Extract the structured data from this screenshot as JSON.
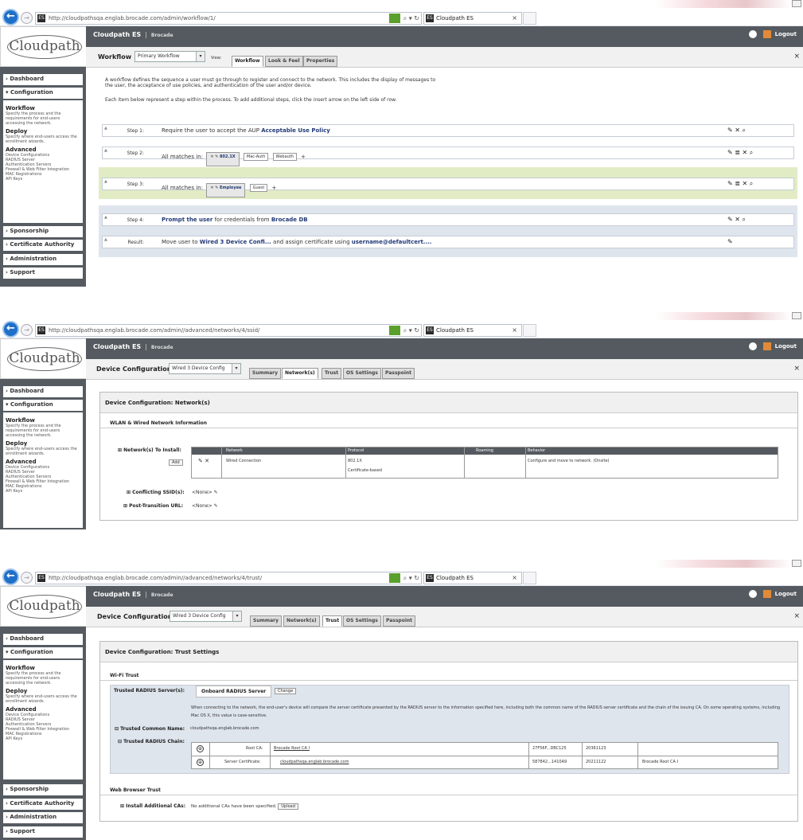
{
  "browser": {
    "tab_title": "Cloudpath ES",
    "url_prefix": "http://cloudpathsqa.englab.",
    "url_domain": "brocade.com",
    "urls": [
      "/admin/workflow/1/",
      "/admin//advanced/networks/4/ssid/",
      "/admin//advanced/networks/4/trust/"
    ],
    "url_controls": "⌕ ▾ ↻",
    "tab_close": "×",
    "back": "←",
    "forward": "→",
    "favicon": "ES"
  },
  "app": {
    "logo_text": "Cloudpath",
    "brand": "Cloudpath ES",
    "brand_sub": "Brocade",
    "brand_sep": "|",
    "logout": "Logout",
    "close": "×"
  },
  "sidebar": {
    "dashboard": "› Dashboard",
    "configuration": "▾ Configuration",
    "workflow_h": "Workflow",
    "workflow_t": "Specify the process and the requirements for end-users accessing the network.",
    "deploy_h": "Deploy",
    "deploy_t": "Specify where end-users access the enrollment wizards.",
    "advanced_h": "Advanced",
    "advanced_items": [
      "Device Configurations",
      "RADIUS Server",
      "Authentication Servers",
      "Firewall & Web Filter Integration",
      "MAC Registrations",
      "API Keys"
    ],
    "sponsorship": "› Sponsorship",
    "cert_auth": "› Certificate Authority",
    "administration": "› Administration",
    "support": "› Support"
  },
  "workflow": {
    "label": "Workflow",
    "select": "Primary Workflow",
    "view_label": "View:",
    "tabs": [
      "Workflow",
      "Look & Feel",
      "Properties"
    ],
    "intro_1": "A workflow defines the sequence a user must go through to register and connect to the network. This includes the display of messages to the user, the acceptance of use policies, and authentication of the user and/or device.",
    "intro_2": "Each item below represent a step within the process. To add additional steps, click the insert arrow on the left side of row.",
    "step1_num": "Step 1:",
    "step1_text": "Require the user to accept the AUP",
    "step1_bold": "Acceptable Use Policy",
    "step2_num": "Step 2:",
    "step2_text": "All matches in:",
    "step2_chips": [
      "802.1X",
      "Mac-Auth",
      "Webauth"
    ],
    "step3_num": "Step 3:",
    "step3_text": "All matches in:",
    "step3_chips": [
      "Employee",
      "Guest"
    ],
    "step4_num": "Step 4:",
    "step4_bold": "Prompt the user",
    "step4_text": "for credentials from",
    "step4_bold2": "Brocade DB",
    "result_num": "Result:",
    "result_pre": "Move user to",
    "result_bold": "Wired 3 Device Confi...",
    "result_mid": "and assign certificate using",
    "result_bold2": "username@defaultcert....",
    "plus": "+",
    "acts_std": "✎ ✕ ⌕",
    "acts_list": "✎ ≣ ✕ ⌕",
    "acts_edit": "✎",
    "chip_ctrl": "✕ ✎",
    "grip": "▲"
  },
  "devconf": {
    "label": "Device Configuration",
    "select": "Wired 3 Device Config",
    "tabs": [
      "Summary",
      "Network(s)",
      "Trust",
      "OS Settings",
      "Passpoint"
    ]
  },
  "networks": {
    "heading": "Device Configuration: Network(s)",
    "section": "WLAN & Wired Network Information",
    "nets_label": "Network(s) To Install:",
    "add": "Add",
    "cols": [
      "Network",
      "Protocol",
      "Roaming",
      "Behavior"
    ],
    "row_network": "Wired Connection",
    "row_protocol": "802.1X",
    "row_protocol_sub": "Certificate-based",
    "row_behavior": "Configure and move to network. (Onsite)",
    "row_ctrl": "✎ ✕",
    "ssid_label": "Conflicting SSID(s):",
    "ssid_val": "<None>",
    "ptu_label": "Post-Transition URL:",
    "ptu_val": "<None>",
    "edit": "✎",
    "expand": "⊞"
  },
  "trust": {
    "heading": "Device Configuration: Trust Settings",
    "wifi_section": "Wi-Fi Trust",
    "radius_label": "Trusted RADIUS Server(s):",
    "radius_tab": "Onboard RADIUS Server",
    "change": "Change",
    "desc": "When connecting to the network, the end-user's device will compare the server certificate presented by the RADIUS server to the information specified here, including both the common name of the RADIUS server certificate and the chain of the issuing CA. On some operating systems, including Mac OS X, this value is case-sensitive.",
    "cn_label": "Trusted Common Name:",
    "cn_val": "cloudpathsqa.englab.brocade.com",
    "chain_label": "Trusted RADIUS Chain:",
    "rows": [
      {
        "type": "Root CA:",
        "name": "Brocade Root CA I",
        "thumb": "27F56F...DBC125",
        "date": "20361123",
        "issuer": ""
      },
      {
        "type": "Server Certificate:",
        "name": "cloudpathsqa.englab.brocade.com",
        "thumb": "587842...1410A9",
        "date": "20211122",
        "issuer": "Brocade Root CA I"
      }
    ],
    "web_section": "Web Browser Trust",
    "cas_label": "Install Additional CAs:",
    "cas_val": "No additional CAs have been specified.",
    "upload": "Upload",
    "row_icon": "⊕",
    "toggle": "⊟"
  }
}
